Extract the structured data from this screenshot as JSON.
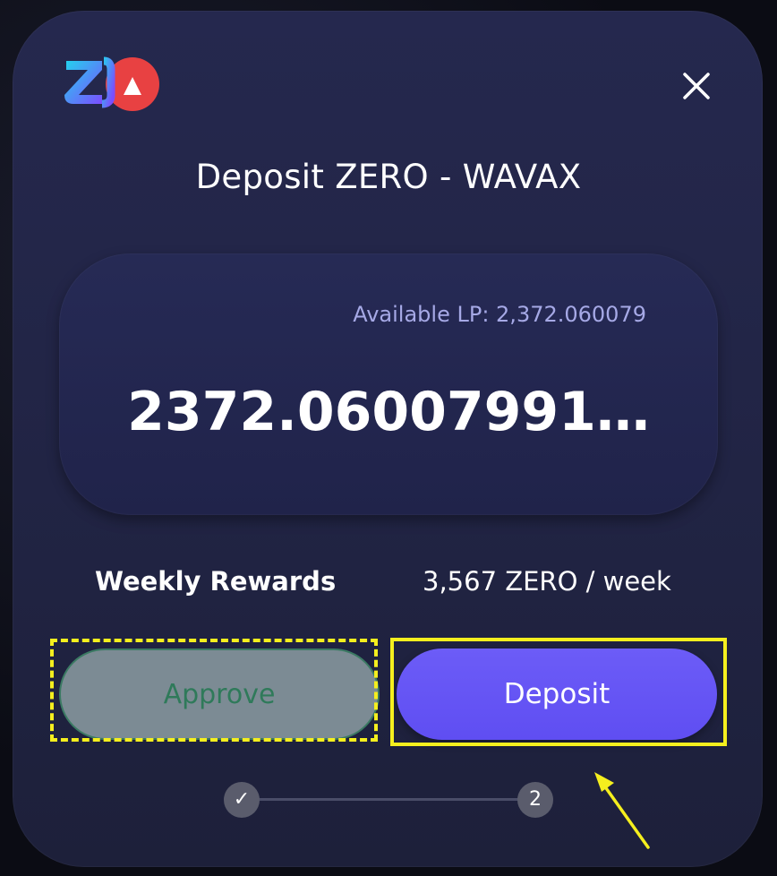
{
  "modal": {
    "title": "Deposit ZERO - WAVAX",
    "close_icon": "close-icon"
  },
  "logo": {
    "icon": "zero-avax-logo"
  },
  "amount": {
    "available_label": "Available LP: 2,372.060079",
    "value": "2372.06007991…"
  },
  "rewards": {
    "label": "Weekly Rewards",
    "value": "3,567 ZERO / week"
  },
  "buttons": {
    "approve_label": "Approve",
    "deposit_label": "Deposit"
  },
  "stepper": {
    "step1_label": "✓",
    "step2_label": "2"
  },
  "colors": {
    "accent": "#6355f5",
    "highlight": "#f5ef1e",
    "approve_bg": "#7c8b94",
    "approve_text": "#2f7a5a"
  }
}
